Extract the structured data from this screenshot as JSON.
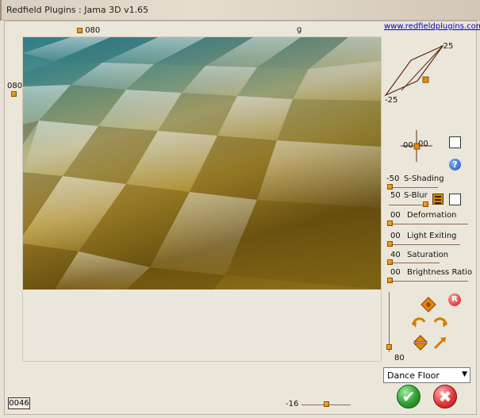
{
  "window": {
    "title": "Redfield Plugins : Jama 3D  v1.65"
  },
  "top_bar": {
    "x_value": "080",
    "g_label": "g",
    "website": "www.redfieldplugins.com"
  },
  "left_marker": {
    "value": "080"
  },
  "rotation": {
    "top_right": "-25",
    "bottom_left": "-25"
  },
  "light_position": {
    "x": "00",
    "y": "00"
  },
  "controls": {
    "s_shading": {
      "value": "-50",
      "label": "S-Shading"
    },
    "s_blur": {
      "value": "50",
      "label": "S-Blur"
    },
    "deformation": {
      "value": "00",
      "label": "Deformation"
    },
    "light_exiting": {
      "value": "00",
      "label": "Light Exiting"
    },
    "saturation": {
      "value": "40",
      "label": "Saturation"
    },
    "brightness_ratio": {
      "value": "00",
      "label": "Brightness Ratio"
    }
  },
  "vertical_slider": {
    "value": "80"
  },
  "preset": {
    "selected": "Dance Floor"
  },
  "bottom": {
    "counter": "0046",
    "zoom_value": "-16"
  },
  "colors": {
    "accent_handle": "#e58a0a",
    "link": "#0000cc",
    "ok": "#2e9d2e",
    "cancel": "#e03a3a"
  }
}
